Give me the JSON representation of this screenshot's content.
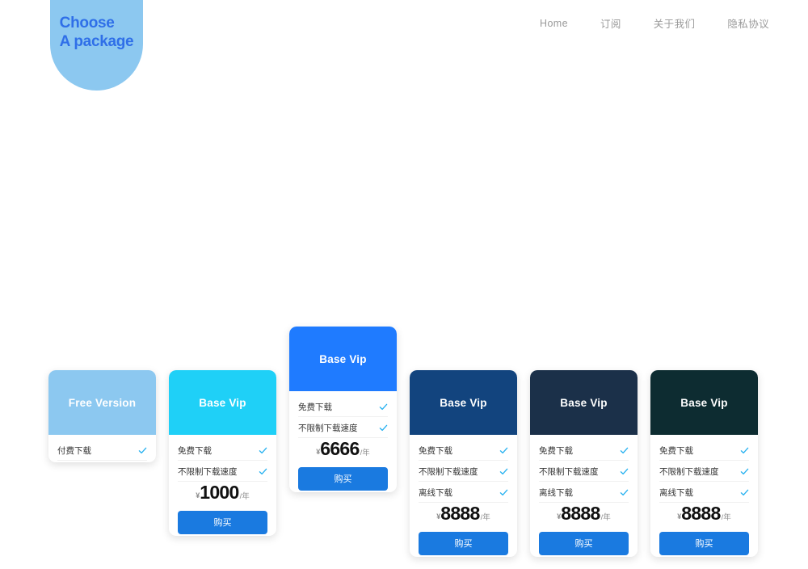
{
  "header": {
    "logo": {
      "line1": "Choose",
      "line2": "A package",
      "text": "Choose\nA package",
      "background": "#8cc8f0",
      "text_color": "#2f6fe8"
    },
    "nav": [
      {
        "label": "Home"
      },
      {
        "label": "订阅"
      },
      {
        "label": "关于我们"
      },
      {
        "label": "隐私协议"
      }
    ]
  },
  "pricing": {
    "currency_symbol": "¥",
    "period_label": "/年",
    "buy_label": "购买",
    "check_icon": "check-icon",
    "accent_button_color": "#1a7ae0",
    "check_color": "#23b0f0",
    "cards": [
      {
        "title": "Free Version",
        "header_color": "#8cc8f0",
        "featured": false,
        "features": [
          "付费下载"
        ],
        "price": "",
        "has_price": false,
        "has_button": false
      },
      {
        "title": "Base Vip",
        "header_color": "#1fd0f7",
        "featured": false,
        "features": [
          "免费下载",
          "不限制下载速度"
        ],
        "price": "1000",
        "has_price": true,
        "has_button": true
      },
      {
        "title": "Base Vip",
        "header_color": "#1f7bff",
        "featured": true,
        "features": [
          "免费下载",
          "不限制下载速度"
        ],
        "price": "6666",
        "has_price": true,
        "has_button": true
      },
      {
        "title": "Base Vip",
        "header_color": "#12447e",
        "featured": false,
        "features": [
          "免费下载",
          "不限制下载速度",
          "离线下载"
        ],
        "price": "8888",
        "has_price": true,
        "has_button": true
      },
      {
        "title": "Base Vip",
        "header_color": "#1b3049",
        "featured": false,
        "features": [
          "免费下载",
          "不限制下载速度",
          "离线下载"
        ],
        "price": "8888",
        "has_price": true,
        "has_button": true
      },
      {
        "title": "Base Vip",
        "header_color": "#0d2c31",
        "featured": false,
        "features": [
          "免费下载",
          "不限制下载速度",
          "离线下载"
        ],
        "price": "8888",
        "has_price": true,
        "has_button": true
      }
    ]
  }
}
